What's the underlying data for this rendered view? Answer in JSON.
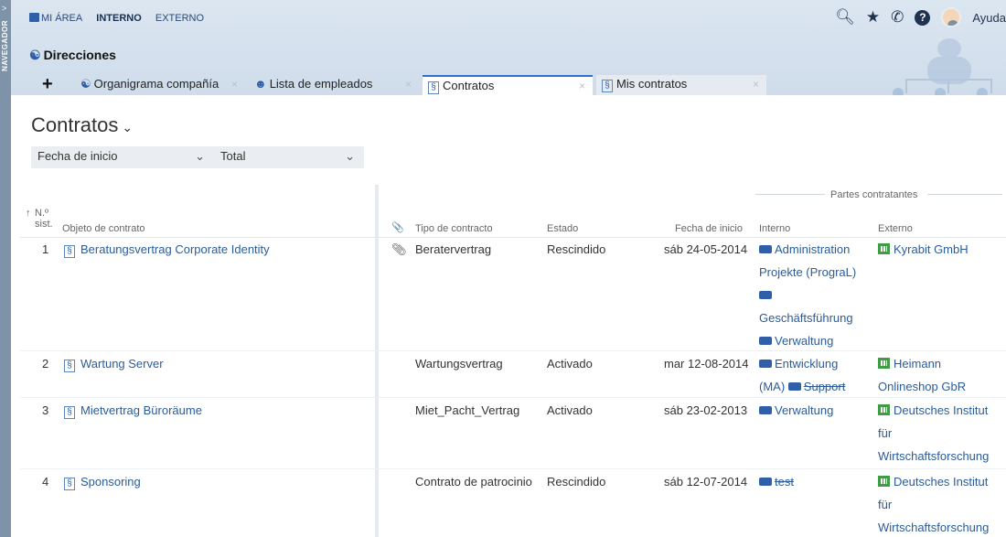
{
  "navigator": {
    "label": "NAVEGADOR",
    "chevron": ">"
  },
  "top_nav": {
    "items": [
      "MI ÁREA",
      "INTERNO",
      "EXTERNO"
    ],
    "active": "INTERNO"
  },
  "top_icons": {
    "help_label": "Ayuda"
  },
  "page_title": "Direcciones",
  "tabs": [
    {
      "label": "Organigrama compañía",
      "icon": "org-chart-icon"
    },
    {
      "label": "Lista de empleados",
      "icon": "employee-list-icon"
    },
    {
      "label": "Contratos",
      "icon": "contract-icon",
      "active": true
    },
    {
      "label": "Mis contratos",
      "icon": "contract-icon"
    }
  ],
  "content": {
    "title": "Contratos",
    "filters": {
      "first": "Fecha de inicio",
      "second": "Total"
    }
  },
  "table": {
    "headers": {
      "sort_arrow": "↑",
      "num": "N.º sist.",
      "object": "Objeto de contrato",
      "attach": "📎",
      "type": "Tipo de contracto",
      "state": "Estado",
      "start": "Fecha de inicio",
      "parties_group": "Partes contratantes",
      "internal": "Interno",
      "external": "Externo"
    },
    "rows": [
      {
        "num": "1",
        "object": "Beratungsvertrag Corporate Identity",
        "has_attachment": true,
        "type": "Beratervertrag",
        "state": "Rescindido",
        "start": "sáb 24-05-2014",
        "internal": [
          "Administration",
          "Projekte (PrograL)",
          "",
          "Geschäftsführung",
          "Verwaltung"
        ],
        "external": [
          "Kyrabit GmbH"
        ]
      },
      {
        "num": "2",
        "object": "Wartung Server",
        "has_attachment": false,
        "type": "Wartungsvertrag",
        "state": "Activado",
        "start": "mar 12-08-2014",
        "internal_a": "Entwicklung",
        "internal_b": "(MA)",
        "internal_c": "Support",
        "external": [
          "Heimann",
          "Onlineshop GbR"
        ]
      },
      {
        "num": "3",
        "object": "Mietvertrag Büroräume",
        "has_attachment": false,
        "type": "Miet_Pacht_Vertrag",
        "state": "Activado",
        "start": "sáb 23-02-2013",
        "internal": [
          "Verwaltung"
        ],
        "external": [
          "Deutsches Institut",
          "für",
          "Wirtschaftsforschung"
        ]
      },
      {
        "num": "4",
        "object": "Sponsoring",
        "has_attachment": false,
        "type": "Contrato de patrocinio",
        "state": "Rescindido",
        "start": "sáb 12-07-2014",
        "internal": [
          "test"
        ],
        "external": [
          "Deutsches Institut",
          "für",
          "Wirtschaftsforschung"
        ]
      }
    ]
  },
  "colors": {
    "accent": "#2f6fd0",
    "link": "#2b5c99",
    "org_green": "#3f9b44",
    "header_bg": "#dbe6f1"
  }
}
